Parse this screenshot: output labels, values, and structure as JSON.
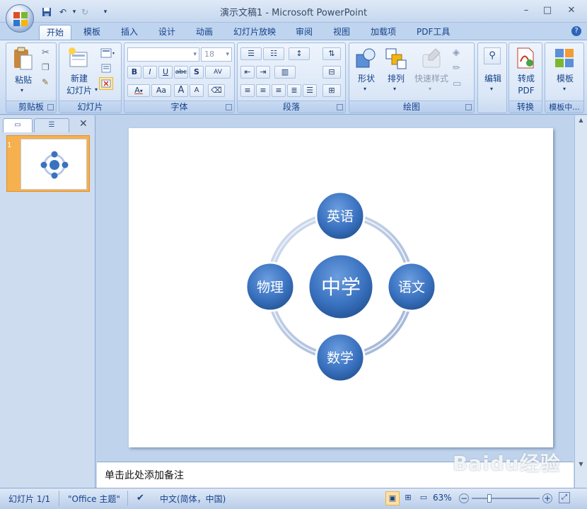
{
  "window": {
    "title": "演示文稿1 - Microsoft PowerPoint",
    "controls": [
      "–",
      "□",
      "✕"
    ]
  },
  "tabs": [
    "开始",
    "模板",
    "插入",
    "设计",
    "动画",
    "幻灯片放映",
    "审阅",
    "视图",
    "加载项",
    "PDF工具"
  ],
  "active_tab": "开始",
  "ribbon": {
    "clipboard": {
      "label": "剪贴板",
      "paste": "粘贴"
    },
    "slides": {
      "label": "幻灯片",
      "new_slide_line1": "新建",
      "new_slide_line2": "幻灯片"
    },
    "font": {
      "label": "字体",
      "size": "18",
      "bold": "B",
      "italic": "I",
      "underline": "U",
      "strike": "abc",
      "shadow": "S",
      "spacing": "AV",
      "aa": "Aa",
      "grow": "A",
      "shrink": "A"
    },
    "paragraph": {
      "label": "段落"
    },
    "drawing": {
      "label": "绘图",
      "shapes": "形状",
      "arrange": "排列",
      "quick_styles": "快速样式"
    },
    "edit": {
      "label": "编辑"
    },
    "convert": {
      "label": "转换",
      "to_pdf_line1": "转成",
      "to_pdf_line2": "PDF"
    },
    "template": {
      "label": "模板中...",
      "template_btn": "模板"
    }
  },
  "slide_panel": {
    "slide_number": "1"
  },
  "slide": {
    "center": "中学",
    "top": "英语",
    "right": "语文",
    "bottom": "数学",
    "left": "物理"
  },
  "notes": {
    "placeholder": "单击此处添加备注"
  },
  "status": {
    "slide_info": "幻灯片 1/1",
    "theme": "\"Office 主题\"",
    "language": "中文(简体，中国)",
    "zoom": "63%"
  },
  "watermark": {
    "text": "Baidu经验",
    "url": "jingyan.baidu.com"
  },
  "colors": {
    "node_fill": "#3a72c0",
    "ring": "#b9c9e3",
    "accent": "#15428b"
  }
}
